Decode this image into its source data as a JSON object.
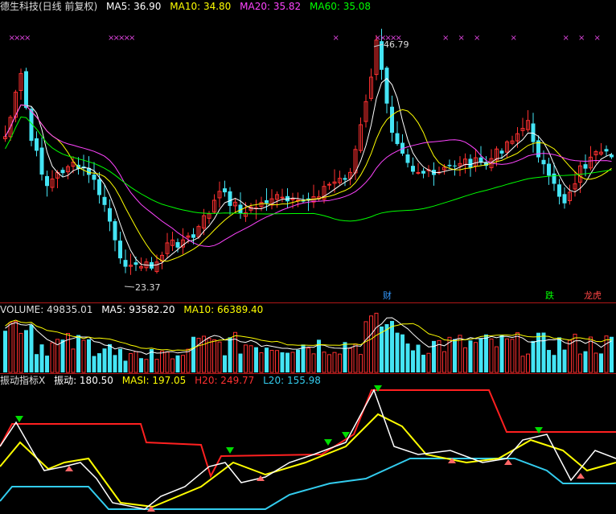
{
  "price": {
    "title": "德生科技(日线 前复权)",
    "ma": [
      {
        "label": "MA5: 36.90",
        "color": "#ffffff"
      },
      {
        "label": "MA10: 34.80",
        "color": "#ffff00"
      },
      {
        "label": "MA20: 35.82",
        "color": "#ff44ff"
      },
      {
        "label": "MA60: 35.08",
        "color": "#00ff00"
      }
    ],
    "high_label": "46.79",
    "low_label": "23.37",
    "markers": [
      {
        "text": "财",
        "color": "#3399ff"
      },
      {
        "text": "跌",
        "color": "#00ff00"
      },
      {
        "text": "龙虎",
        "color": "#ff4444"
      }
    ],
    "x_mark": "×"
  },
  "volume": {
    "title": "VOLUME: 49835.01",
    "ma5": "MA5: 93582.20",
    "ma10": "MA10: 66389.40"
  },
  "oscillator": {
    "title": "振动指标X",
    "lines": [
      {
        "label": "振动: 180.50",
        "color": "#ffffff"
      },
      {
        "label": "MASI: 197.05",
        "color": "#ffff00"
      },
      {
        "label": "H20: 249.77",
        "color": "#ff3030"
      },
      {
        "label": "L20: 155.98",
        "color": "#33ccee"
      }
    ]
  },
  "colors": {
    "up": "#ff3030",
    "down": "#44e4f4",
    "grid": "#b01818"
  }
}
